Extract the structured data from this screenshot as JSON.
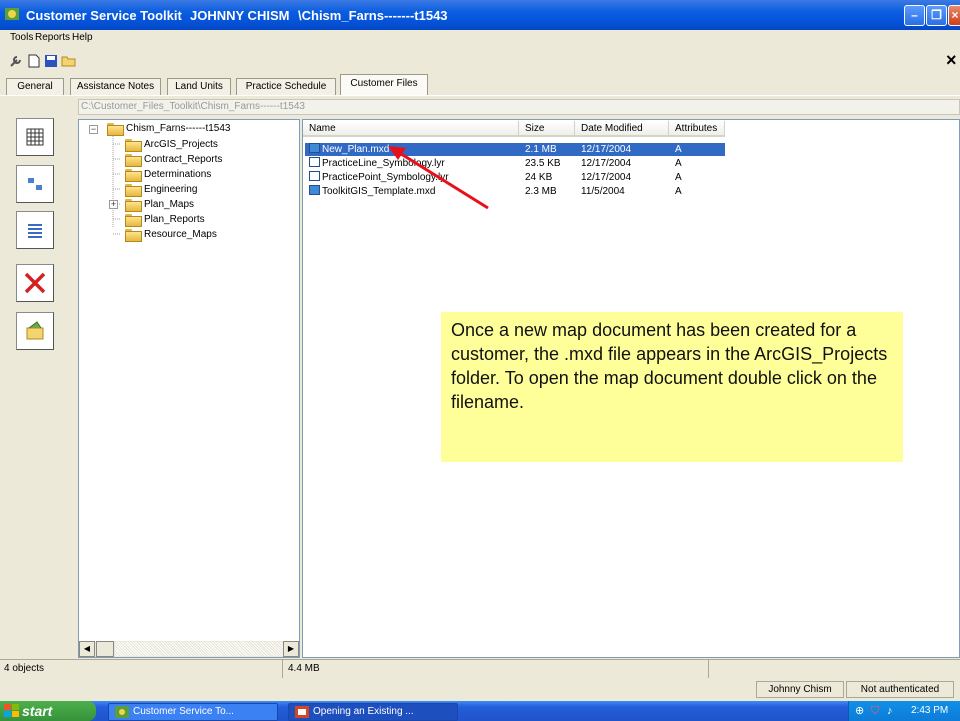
{
  "window": {
    "app_title": "Customer Service Toolkit",
    "user": "JOHNNY CHISM",
    "path": "\\Chism_Farns-------t1543"
  },
  "menu": [
    "Tools",
    "Reports",
    "Help"
  ],
  "tabs": [
    "General",
    "Assistance Notes",
    "Land Units",
    "Practice Schedule",
    "Customer Files"
  ],
  "active_tab": "Customer Files",
  "path_field": "C:\\Customer_Files_Toolkit\\Chism_Farns------t1543",
  "tree": {
    "root": "Chism_Farns------t1543",
    "children": [
      "ArcGIS_Projects",
      "Contract_Reports",
      "Determinations",
      "Engineering",
      "Plan_Maps",
      "Plan_Reports",
      "Resource_Maps"
    ]
  },
  "file_columns": [
    "Name",
    "Size",
    "Date Modified",
    "Attributes"
  ],
  "files": [
    {
      "name": "New_Plan.mxd",
      "size": "2.1 MB",
      "date": "12/17/2004",
      "attr": "A"
    },
    {
      "name": "PracticeLine_Symbology.lyr",
      "size": "23.5 KB",
      "date": "12/17/2004",
      "attr": "A"
    },
    {
      "name": "PracticePoint_Symbology.lyr",
      "size": "24 KB",
      "date": "12/17/2004",
      "attr": "A"
    },
    {
      "name": "ToolkitGIS_Template.mxd",
      "size": "2.3 MB",
      "date": "11/5/2004",
      "attr": "A"
    }
  ],
  "callout": "Once a new map document has been created for a customer, the .mxd file appears in the ArcGIS_Projects folder. To open the map document double click on the filename.",
  "status": {
    "objects": "4 objects",
    "total": "4.4 MB"
  },
  "status2": {
    "user": "Johnny Chism",
    "auth": "Not authenticated"
  },
  "taskbar": {
    "start": "start",
    "task1": "Customer Service To...",
    "task2": "Opening an Existing ...",
    "time": "2:43 PM"
  }
}
